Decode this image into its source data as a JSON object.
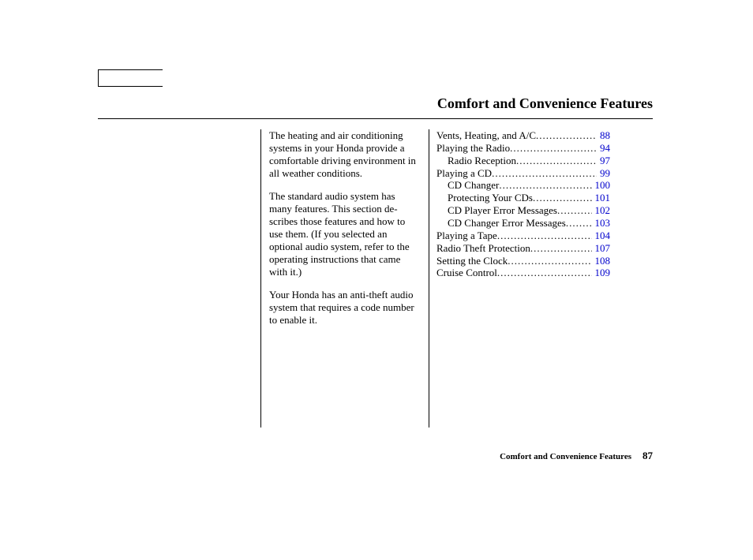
{
  "header": {
    "title": "Comfort and Convenience Features"
  },
  "intro": {
    "p1": "The heating and air conditioning systems in your Honda provide a comfortable driving environment in all weather conditions.",
    "p2": "The standard audio system has many features. This section de-scribes those features and how to use them. (If you selected an optional audio system, refer to the operating instructions that came with it.)",
    "p3": "Your Honda has an anti-theft audio system that requires a code number to enable it."
  },
  "toc": [
    {
      "label": "Vents, Heating, and A/C",
      "page": "88",
      "indent": false
    },
    {
      "label": "Playing the Radio",
      "page": "94",
      "indent": false
    },
    {
      "label": "Radio Reception",
      "page": "97",
      "indent": true
    },
    {
      "label": "Playing a CD",
      "page": "99",
      "indent": false
    },
    {
      "label": "CD Changer",
      "page": "100",
      "indent": true
    },
    {
      "label": "Protecting Your CDs",
      "page": "101",
      "indent": true
    },
    {
      "label": "CD Player Error Messages",
      "page": "102",
      "indent": true
    },
    {
      "label": "CD Changer Error Messages",
      "page": "103",
      "indent": true
    },
    {
      "label": "Playing a Tape",
      "page": "104",
      "indent": false
    },
    {
      "label": "Radio Theft Protection",
      "page": "107",
      "indent": false
    },
    {
      "label": "Setting the Clock",
      "page": "108",
      "indent": false
    },
    {
      "label": "Cruise Control",
      "page": "109",
      "indent": false
    }
  ],
  "footer": {
    "section": "Comfort and Convenience Features",
    "page": "87"
  }
}
